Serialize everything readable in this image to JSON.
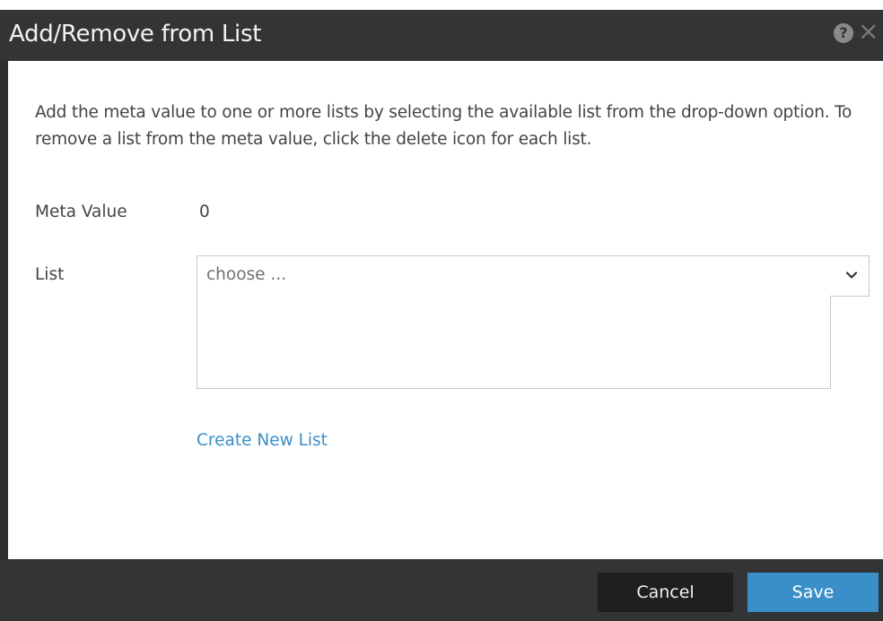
{
  "dialog": {
    "title": "Add/Remove from List",
    "help_icon": "?",
    "close_icon": "×",
    "description": "Add the meta value to one or more lists by selecting the available list from the drop-down option. To remove a list from the meta value, click the delete icon for each list."
  },
  "form": {
    "meta_value_label": "Meta Value",
    "meta_value": "0",
    "list_label": "List",
    "list_placeholder": "choose ...",
    "create_new_list": "Create New List"
  },
  "footer": {
    "cancel_label": "Cancel",
    "save_label": "Save"
  },
  "colors": {
    "title_bar": "#333435",
    "accent": "#3a8fc8",
    "cancel_button": "#1e1f20"
  },
  "icons": {
    "help": "help-icon",
    "close": "close-icon",
    "dropdown": "chevron-down-icon"
  }
}
